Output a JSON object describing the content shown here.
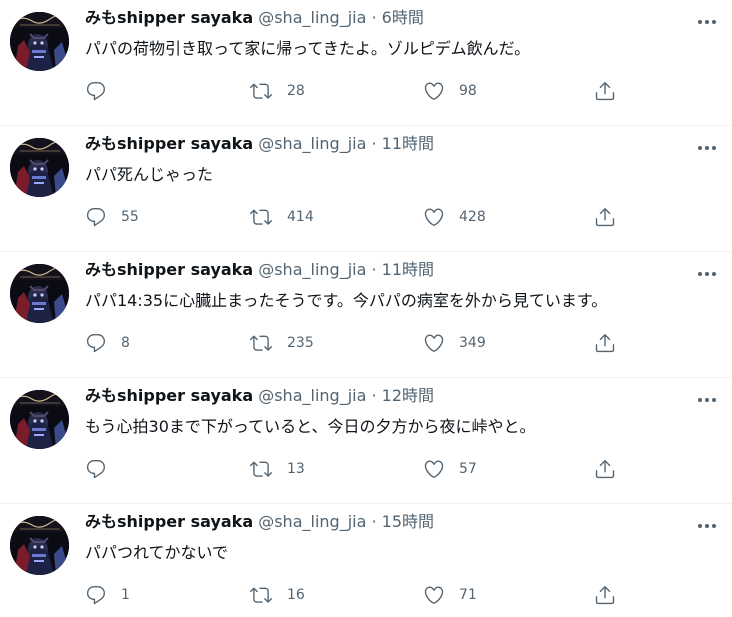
{
  "colors": {
    "text_primary": "#0f1419",
    "text_secondary": "#536471",
    "divider": "#eff3f4",
    "background": "#ffffff"
  },
  "icons": {
    "reply": "reply-icon",
    "retweet": "retweet-icon",
    "like": "like-icon",
    "share": "share-icon",
    "more": "more-icon"
  },
  "tweets": [
    {
      "name": "みもshipper sayaka",
      "handle": "@sha_ling_jia",
      "separator": "·",
      "time": "6時間",
      "text": "パパの荷物引き取って家に帰ってきたよ。ゾルピデム飲んだ。",
      "replies": "",
      "retweets": "28",
      "likes": "98"
    },
    {
      "name": "みもshipper sayaka",
      "handle": "@sha_ling_jia",
      "separator": "·",
      "time": "11時間",
      "text": "パパ死んじゃった",
      "replies": "55",
      "retweets": "414",
      "likes": "428"
    },
    {
      "name": "みもshipper sayaka",
      "handle": "@sha_ling_jia",
      "separator": "·",
      "time": "11時間",
      "text": "パパ14:35に心臓止まったそうです。今パパの病室を外から見ています。",
      "replies": "8",
      "retweets": "235",
      "likes": "349"
    },
    {
      "name": "みもshipper sayaka",
      "handle": "@sha_ling_jia",
      "separator": "·",
      "time": "12時間",
      "text": "もう心拍30まで下がっていると、今日の夕方から夜に峠やと。",
      "replies": "",
      "retweets": "13",
      "likes": "57"
    },
    {
      "name": "みもshipper sayaka",
      "handle": "@sha_ling_jia",
      "separator": "·",
      "time": "15時間",
      "text": "パパつれてかないで",
      "replies": "1",
      "retweets": "16",
      "likes": "71"
    }
  ]
}
